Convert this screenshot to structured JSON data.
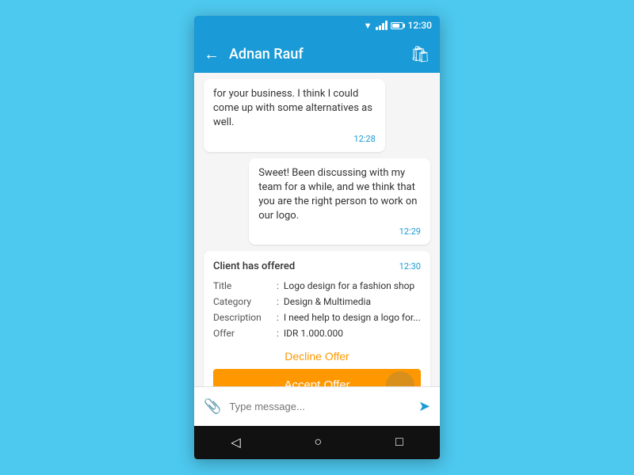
{
  "statusBar": {
    "time": "12:30"
  },
  "appBar": {
    "title": "Adnan Rauf",
    "backLabel": "←"
  },
  "messages": [
    {
      "text": "for your business. I think I could come up with some alternatives as well.",
      "time": "12:28",
      "side": "left"
    },
    {
      "text": "Sweet! Been discussing with my team for a while, and we think that you are the right person to work on our logo.",
      "time": "12:29",
      "side": "right"
    }
  ],
  "offerCard": {
    "header": "Client has offered",
    "time": "12:30",
    "rows": [
      {
        "label": "Title",
        "value": "Logo design for a fashion shop"
      },
      {
        "label": "Category",
        "value": "Design & Multimedia"
      },
      {
        "label": "Description",
        "value": "I need help to design a logo for..."
      },
      {
        "label": "Offer",
        "value": "IDR 1.000.000"
      }
    ],
    "declineLabel": "Decline Offer",
    "acceptLabel": "Accept Offer"
  },
  "inputArea": {
    "placeholder": "Type message..."
  },
  "navBar": {
    "backBtn": "◁",
    "homeBtn": "○",
    "squareBtn": "□"
  }
}
